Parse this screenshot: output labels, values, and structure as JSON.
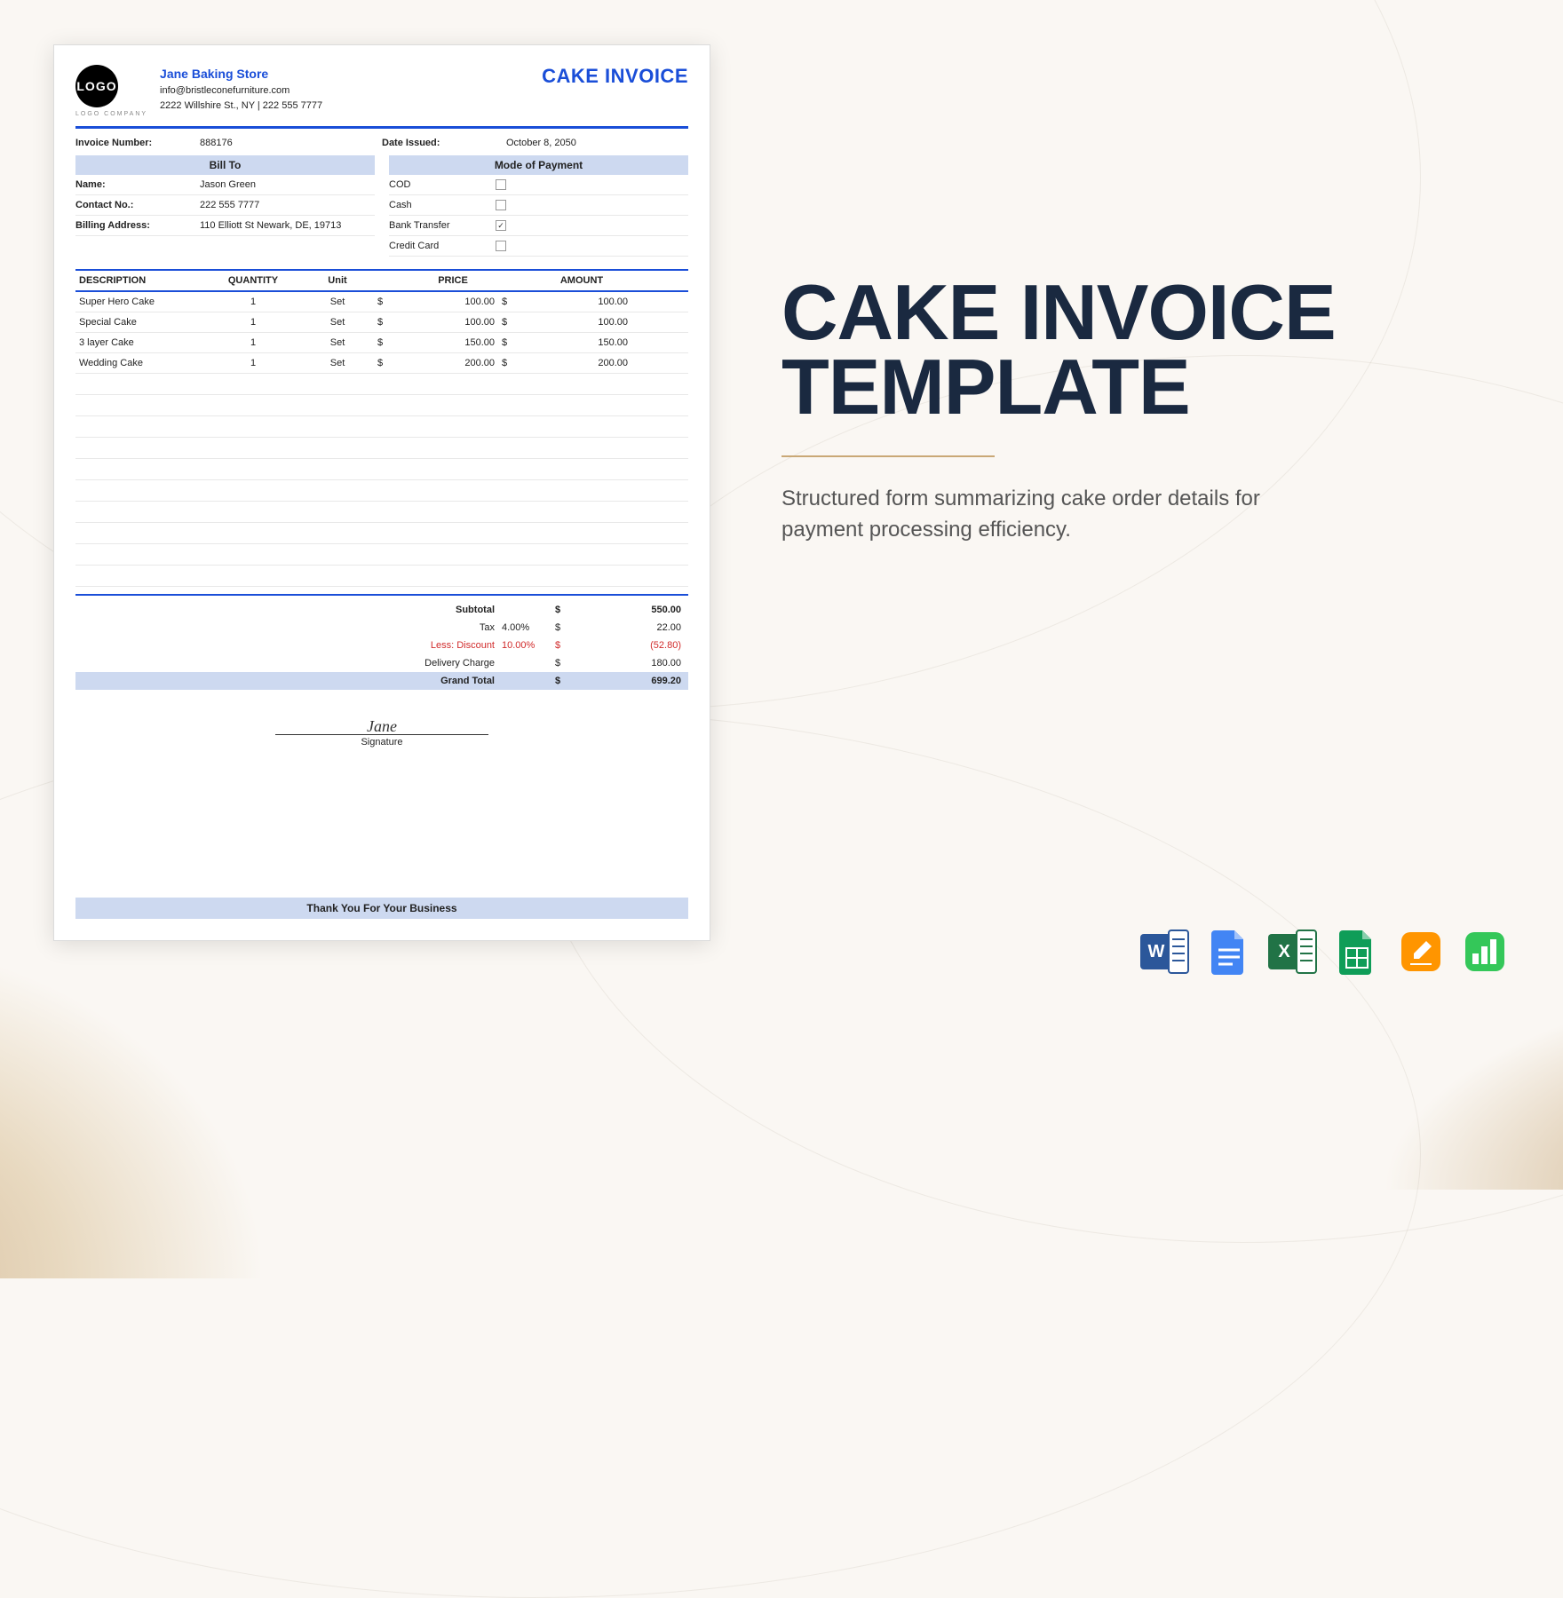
{
  "template": {
    "title_line1": "CAKE INVOICE",
    "title_line2": "TEMPLATE",
    "description": "Structured form summarizing cake order details for payment processing efficiency."
  },
  "invoice": {
    "logo_text": "LOGO",
    "logo_caption": "LOGO COMPANY",
    "company_name": "Jane Baking Store",
    "company_email": "info@bristleconefurniture.com",
    "company_address": "2222 Willshire St., NY | 222 555 7777",
    "doc_title": "CAKE INVOICE",
    "invoice_number_label": "Invoice Number:",
    "invoice_number": "888176",
    "date_issued_label": "Date Issued:",
    "date_issued": "October 8, 2050",
    "bill_to_header": "Bill To",
    "payment_header": "Mode of Payment",
    "bill_to": {
      "name_label": "Name:",
      "name": "Jason Green",
      "contact_label": "Contact No.:",
      "contact": "222 555 7777",
      "address_label": "Billing Address:",
      "address": "110 Elliott St Newark, DE, 19713"
    },
    "payment_modes": [
      {
        "label": "COD",
        "checked": false
      },
      {
        "label": "Cash",
        "checked": false
      },
      {
        "label": "Bank Transfer",
        "checked": true
      },
      {
        "label": "Credit Card",
        "checked": false
      }
    ],
    "columns": {
      "description": "DESCRIPTION",
      "quantity": "QUANTITY",
      "unit": "Unit",
      "price": "PRICE",
      "amount": "AMOUNT"
    },
    "currency": "$",
    "items": [
      {
        "desc": "Super Hero Cake",
        "qty": "1",
        "unit": "Set",
        "price": "100.00",
        "amount": "100.00"
      },
      {
        "desc": "Special Cake",
        "qty": "1",
        "unit": "Set",
        "price": "100.00",
        "amount": "100.00"
      },
      {
        "desc": "3 layer Cake",
        "qty": "1",
        "unit": "Set",
        "price": "150.00",
        "amount": "150.00"
      },
      {
        "desc": "Wedding Cake",
        "qty": "1",
        "unit": "Set",
        "price": "200.00",
        "amount": "200.00"
      }
    ],
    "totals": {
      "subtotal_label": "Subtotal",
      "subtotal": "550.00",
      "tax_label": "Tax",
      "tax_rate": "4.00%",
      "tax": "22.00",
      "discount_label": "Less: Discount",
      "discount_rate": "10.00%",
      "discount": "(52.80)",
      "delivery_label": "Delivery Charge",
      "delivery": "180.00",
      "grand_label": "Grand Total",
      "grand": "699.20"
    },
    "signature_label": "Signature",
    "signature_name": "Jane",
    "footer": "Thank You For Your Business"
  },
  "app_icons": [
    {
      "name": "word",
      "color": "#2b579a",
      "letter": "W"
    },
    {
      "name": "google-docs",
      "color": "#4285f4"
    },
    {
      "name": "excel",
      "color": "#217346",
      "letter": "X"
    },
    {
      "name": "google-sheets",
      "color": "#0f9d58"
    },
    {
      "name": "pages",
      "color": "#ff9500"
    },
    {
      "name": "numbers",
      "color": "#34c759"
    }
  ]
}
